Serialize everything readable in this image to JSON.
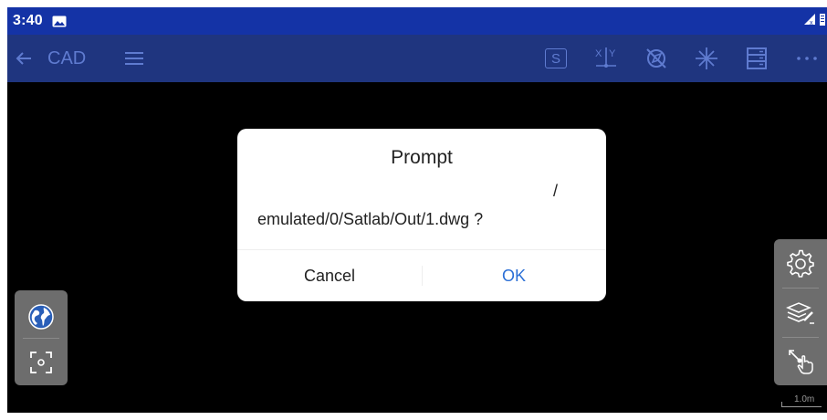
{
  "status_bar": {
    "time": "3:40",
    "image_icon": "image-icon",
    "signal_icon": "signal-icon",
    "battery_icon": "battery-icon"
  },
  "toolbar": {
    "back_icon": "back-arrow-icon",
    "title": "CAD",
    "menu_icon": "hamburger-menu-icon",
    "s_button_label": "S",
    "xy_icon": "xy-axis-icon",
    "no_compass_icon": "compass-off-icon",
    "crosshair_icon": "crosshair-snap-icon",
    "layers_list_icon": "layer-list-icon",
    "more_icon": "more-icon"
  },
  "dialog": {
    "title": "Prompt",
    "message_line1": "/",
    "message_line2": "emulated/0/Satlab/Out/1.dwg ?",
    "cancel_label": "Cancel",
    "ok_label": "OK"
  },
  "left_panel": {
    "globe_icon": "globe-icon",
    "zoom_extent_icon": "zoom-extent-icon"
  },
  "right_panel": {
    "settings_icon": "settings-icon",
    "layers_icon": "layers-edit-icon",
    "select_icon": "select-pointer-icon"
  },
  "scale": {
    "label": "1.0m"
  },
  "colors": {
    "status_bar_bg": "#1433a6",
    "toolbar_bg": "#1f357f",
    "toolbar_icon": "#5f7bd0",
    "canvas_bg": "#000000",
    "ok_text": "#2b6fd6",
    "panel_bg": "#6d6d6d"
  }
}
